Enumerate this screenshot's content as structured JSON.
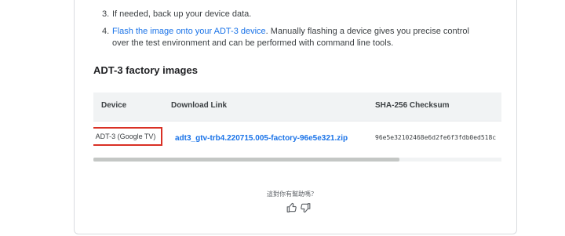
{
  "steps": [
    {
      "number": "3.",
      "text": "If needed, back up your device data."
    },
    {
      "number": "4.",
      "link": "Flash the image onto your ADT-3 device",
      "text_after": ". Manually flashing a device gives you precise control over the test environment and can be performed with command line tools."
    }
  ],
  "section_heading": "ADT-3 factory images",
  "table": {
    "headers": [
      "Device",
      "Download Link",
      "SHA-256 Checksum"
    ],
    "rows": [
      {
        "device": "ADT-3 (Google TV)",
        "download_link": "adt3_gtv-trb4.220715.005-factory-96e5e321.zip",
        "sha256": "96e5e32102468e6d2fe6f3fdb0ed518c"
      }
    ],
    "scroll_fraction": 0.75
  },
  "feedback": {
    "question": "這對你有幫助嗎？",
    "icons": [
      "thumb-up-icon",
      "thumb-down-icon"
    ]
  },
  "colors": {
    "link": "#1a73e8",
    "highlight_border": "#d93025",
    "header_bg": "#f1f3f4"
  }
}
